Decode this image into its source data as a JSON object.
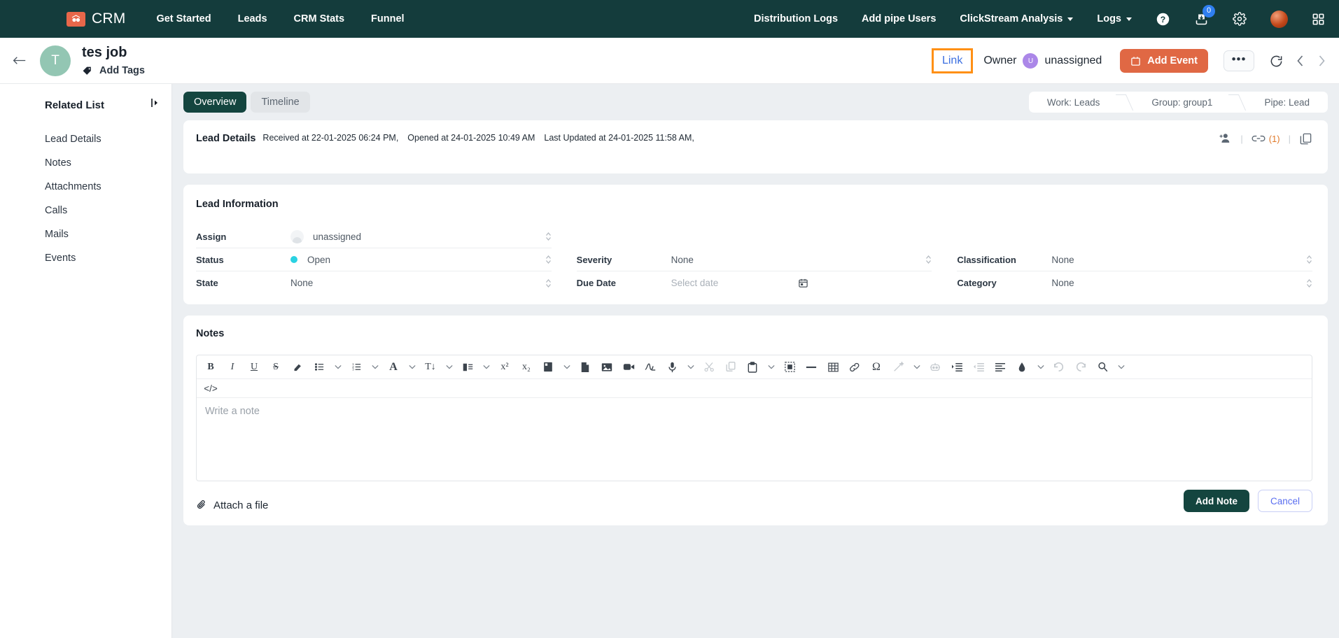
{
  "topnav": {
    "brand": "CRM",
    "links": [
      "Get Started",
      "Leads",
      "CRM Stats",
      "Funnel"
    ],
    "right_links": [
      "Distribution Logs",
      "Add pipe Users"
    ],
    "dropdowns": [
      "ClickStream Analysis",
      "Logs"
    ],
    "notification_badge": "0",
    "accent_logo_color": "#e8674a",
    "bar_color": "#143c3c"
  },
  "header": {
    "avatar_letter": "T",
    "title": "tes job",
    "add_tags": "Add Tags",
    "link_label": "Link",
    "link_highlight_color": "#ff9015",
    "owner_label": "Owner",
    "owner_initial": "U",
    "owner_name": "unassigned",
    "add_event_label": "Add Event",
    "add_event_color": "#e06844",
    "more_label": "•••"
  },
  "sidebar": {
    "heading": "Related List",
    "items": [
      "Lead Details",
      "Notes",
      "Attachments",
      "Calls",
      "Mails",
      "Events"
    ]
  },
  "main": {
    "tabs": [
      {
        "label": "Overview",
        "active": true
      },
      {
        "label": "Timeline",
        "active": false
      }
    ],
    "breadcrumb": [
      "Work: Leads",
      "Group: group1",
      "Pipe: Lead"
    ],
    "lead_details": {
      "title": "Lead Details",
      "received": "Received at 22-01-2025 06:24 PM,",
      "opened": "Opened at 24-01-2025 10:49 AM",
      "last_updated": "Last Updated at 24-01-2025 11:58 AM,",
      "link_count": "(1)"
    },
    "lead_information": {
      "title": "Lead Information",
      "fields": [
        {
          "label": "Assign",
          "value": "unassigned",
          "column": 1
        },
        {
          "label": "Status",
          "value": "Open",
          "column": 1,
          "dot_color": "#2ad2e2"
        },
        {
          "label": "State",
          "value": "None",
          "column": 1
        },
        {
          "label": "Severity",
          "value": "None",
          "column": 2
        },
        {
          "label": "Due Date",
          "value": "Select date",
          "column": 2,
          "placeholder": true
        },
        {
          "label": "Classification",
          "value": "None",
          "column": 3
        },
        {
          "label": "Category",
          "value": "None",
          "column": 3
        }
      ]
    },
    "notes": {
      "title": "Notes",
      "editor_placeholder": "Write a note",
      "code_tag": "</>",
      "attach_label": "Attach a file",
      "add_note_label": "Add Note",
      "cancel_label": "Cancel"
    }
  }
}
